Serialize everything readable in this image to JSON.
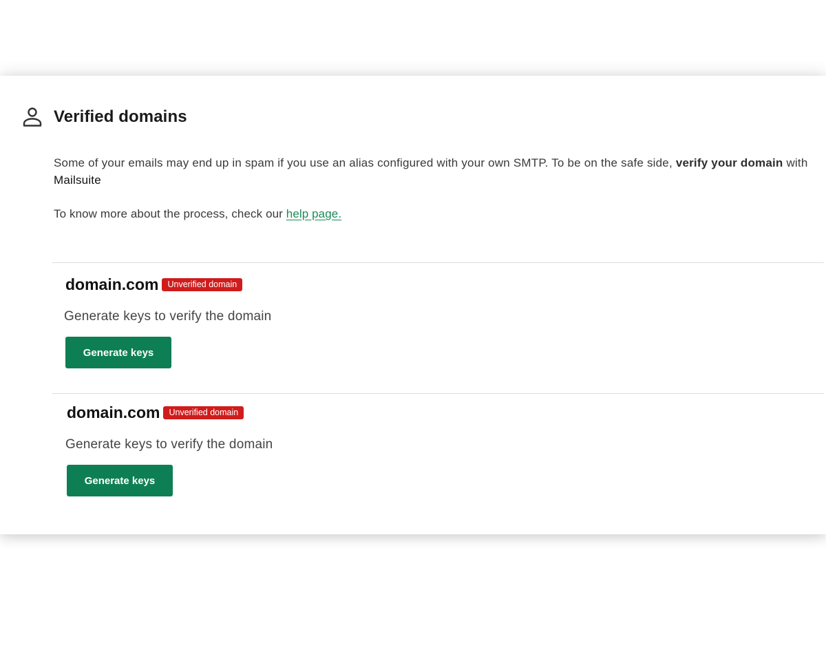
{
  "section": {
    "title": "Verified domains",
    "icon": "user-icon"
  },
  "intro": {
    "text_before": "Some of your emails may end up in spam if you use an alias configured with your own SMTP. To be on the safe side, ",
    "bold_text": "verify your domain",
    "text_with": " with ",
    "brand": "Mailsuite"
  },
  "help": {
    "prefix": "To know more about the process, check our ",
    "link_text": "help page."
  },
  "domains": [
    {
      "name": "domain.com",
      "badge": "Unverified domain",
      "description": "Generate keys to verify the domain",
      "button_label": "Generate keys"
    },
    {
      "name": "domain.com",
      "badge": "Unverified domain",
      "description": "Generate keys to verify the domain",
      "button_label": "Generate keys"
    }
  ],
  "colors": {
    "accent_green": "#0e7f55",
    "link_green": "#1b8a5a",
    "badge_red": "#d01c1c"
  }
}
